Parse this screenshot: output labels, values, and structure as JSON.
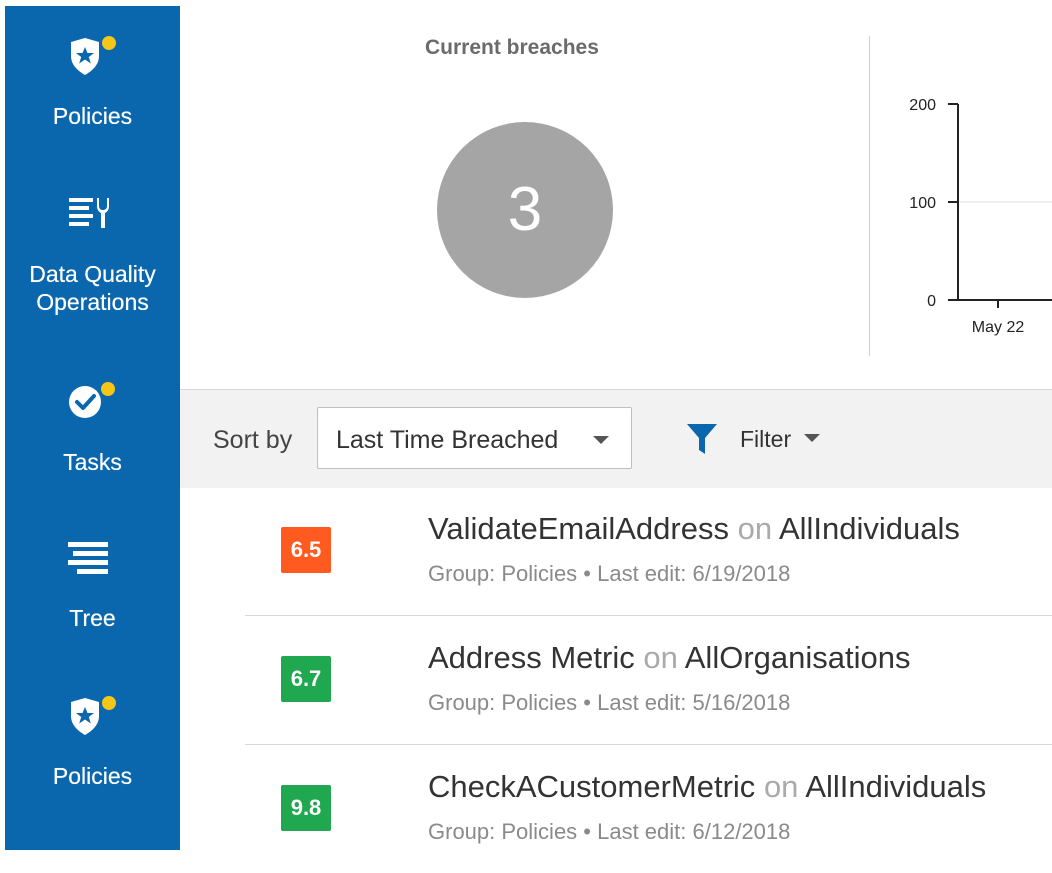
{
  "sidebar": {
    "items": [
      {
        "label": "Policies",
        "icon": "shield-star-icon",
        "notification": true
      },
      {
        "label": "Data Quality Operations",
        "label_lines": [
          "Data Quality",
          "Operations"
        ],
        "icon": "list-wrench-icon",
        "notification": false
      },
      {
        "label": "Tasks",
        "icon": "check-circle-icon",
        "notification": true
      },
      {
        "label": "Tree",
        "icon": "tree-list-icon",
        "notification": false
      },
      {
        "label": "Policies",
        "icon": "shield-star-icon",
        "notification": true
      }
    ]
  },
  "summary": {
    "title": "Current breaches",
    "count": "3",
    "chart": {
      "y_ticks": [
        "200",
        "100",
        "0"
      ],
      "x_ticks": [
        "May 22"
      ]
    }
  },
  "toolbar": {
    "sort_label": "Sort by",
    "sort_value": "Last Time Breached",
    "filter_label": "Filter"
  },
  "list": [
    {
      "score": "6.5",
      "score_color": "#ff5a1f",
      "name": "ValidateEmailAddress",
      "on": "on",
      "target": "AllIndividuals",
      "meta": "Group: Policies • Last edit: 6/19/2018"
    },
    {
      "score": "6.7",
      "score_color": "#1fa84f",
      "name": "Address Metric",
      "on": "on",
      "target": "AllOrganisations",
      "meta": "Group: Policies • Last edit: 5/16/2018"
    },
    {
      "score": "9.8",
      "score_color": "#1fa84f",
      "name": "CheckACustomerMetric",
      "on": "on",
      "target": "AllIndividuals",
      "meta": "Group: Policies • Last edit: 6/12/2018"
    }
  ],
  "colors": {
    "sidebar": "#0a67ad",
    "notification": "#f5c518",
    "filter_icon": "#0a67ad"
  }
}
